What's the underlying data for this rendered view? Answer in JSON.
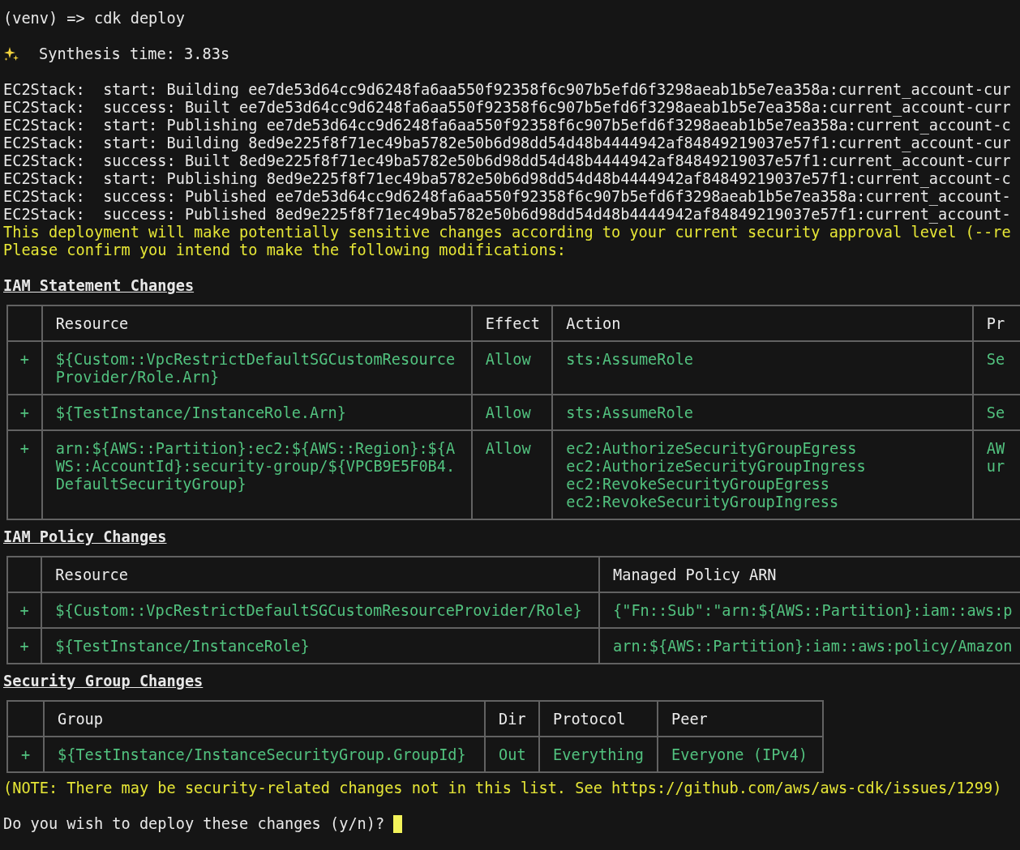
{
  "command": "(venv) => cdk deploy",
  "synthesis": "Synthesis time: 3.83s",
  "log_lines": [
    "EC2Stack:  start: Building ee7de53d64cc9d6248fa6aa550f92358f6c907b5efd6f3298aeab1b5e7ea358a:current_account-cur",
    "EC2Stack:  success: Built ee7de53d64cc9d6248fa6aa550f92358f6c907b5efd6f3298aeab1b5e7ea358a:current_account-curr",
    "EC2Stack:  start: Publishing ee7de53d64cc9d6248fa6aa550f92358f6c907b5efd6f3298aeab1b5e7ea358a:current_account-c",
    "EC2Stack:  start: Building 8ed9e225f8f71ec49ba5782e50b6d98dd54d48b4444942af84849219037e57f1:current_account-cur",
    "EC2Stack:  success: Built 8ed9e225f8f71ec49ba5782e50b6d98dd54d48b4444942af84849219037e57f1:current_account-curr",
    "EC2Stack:  start: Publishing 8ed9e225f8f71ec49ba5782e50b6d98dd54d48b4444942af84849219037e57f1:current_account-c",
    "EC2Stack:  success: Published ee7de53d64cc9d6248fa6aa550f92358f6c907b5efd6f3298aeab1b5e7ea358a:current_account-",
    "EC2Stack:  success: Published 8ed9e225f8f71ec49ba5782e50b6d98dd54d48b4444942af84849219037e57f1:current_account-"
  ],
  "warnings": [
    "This deployment will make potentially sensitive changes according to your current security approval level (--re",
    "Please confirm you intend to make the following modifications:"
  ],
  "sections": [
    {
      "title": "IAM Statement Changes",
      "columns": [
        "Resource",
        "Effect",
        "Action",
        "Pr"
      ],
      "rows": [
        {
          "marker": "+",
          "cells": [
            [
              "${Custom::VpcRestrictDefaultSGCustomResource",
              "Provider/Role.Arn}"
            ],
            [
              "Allow"
            ],
            [
              "sts:AssumeRole"
            ],
            [
              "Se"
            ]
          ]
        },
        {
          "marker": "+",
          "cells": [
            [
              "${TestInstance/InstanceRole.Arn}"
            ],
            [
              "Allow"
            ],
            [
              "sts:AssumeRole"
            ],
            [
              "Se"
            ]
          ]
        },
        {
          "marker": "+",
          "cells": [
            [
              "arn:${AWS::Partition}:ec2:${AWS::Region}:${A",
              "WS::AccountId}:security-group/${VPCB9E5F0B4.",
              "DefaultSecurityGroup}"
            ],
            [
              "Allow"
            ],
            [
              "ec2:AuthorizeSecurityGroupEgress",
              "ec2:AuthorizeSecurityGroupIngress",
              "ec2:RevokeSecurityGroupEgress",
              "ec2:RevokeSecurityGroupIngress"
            ],
            [
              "AW",
              "ur"
            ]
          ]
        }
      ]
    },
    {
      "title": "IAM Policy Changes",
      "columns": [
        "Resource",
        "Managed Policy ARN"
      ],
      "rows": [
        {
          "marker": "+",
          "cells": [
            [
              "${Custom::VpcRestrictDefaultSGCustomResourceProvider/Role}"
            ],
            [
              "{\"Fn::Sub\":\"arn:${AWS::Partition}:iam::aws:p"
            ]
          ]
        },
        {
          "marker": "+",
          "cells": [
            [
              "${TestInstance/InstanceRole}"
            ],
            [
              "arn:${AWS::Partition}:iam::aws:policy/Amazon"
            ]
          ]
        }
      ]
    },
    {
      "title": "Security Group Changes",
      "columns": [
        "Group",
        "Dir",
        "Protocol",
        "Peer"
      ],
      "rows": [
        {
          "marker": "+",
          "cells": [
            [
              "${TestInstance/InstanceSecurityGroup.GroupId}"
            ],
            [
              "Out"
            ],
            [
              "Everything"
            ],
            [
              "Everyone (IPv4)"
            ]
          ]
        }
      ]
    }
  ],
  "note": "(NOTE: There may be security-related changes not in this list. See https://github.com/aws/aws-cdk/issues/1299)",
  "question": "Do you wish to deploy these changes (y/n)?"
}
